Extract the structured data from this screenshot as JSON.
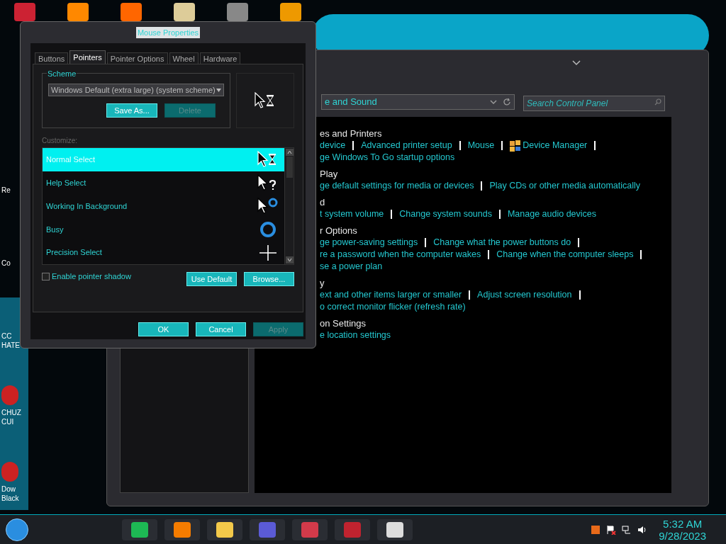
{
  "desktop": {
    "icon_labels": [
      {
        "lines": [
          "Re"
        ]
      },
      {
        "lines": [
          "Co"
        ]
      },
      {
        "lines": [
          "CC",
          "HATE"
        ]
      },
      {
        "lines": [
          "CHUZ",
          "CUI"
        ]
      },
      {
        "lines": [
          "Dow",
          "Black"
        ]
      }
    ]
  },
  "control_panel": {
    "address": "e and Sound",
    "search": {
      "placeholder": "Search Control Panel"
    },
    "sections": [
      {
        "heading": "es and Printers",
        "rows": [
          {
            "links": [
              {
                "text": "device",
                "kind": "plain"
              },
              {
                "text": "Advanced printer setup",
                "kind": "plain"
              },
              {
                "text": "Mouse",
                "kind": "plain"
              },
              {
                "text": "Device Manager",
                "kind": "with-icon"
              }
            ],
            "trailing_separator": true
          },
          {
            "links": [
              {
                "text": "ge Windows To Go startup options",
                "kind": "plain"
              }
            ],
            "trailing_separator": false
          }
        ]
      },
      {
        "heading": "Play",
        "rows": [
          {
            "links": [
              {
                "text": "ge default settings for media or devices",
                "kind": "plain"
              },
              {
                "text": "Play CDs or other media automatically",
                "kind": "plain"
              }
            ],
            "trailing_separator": false
          }
        ]
      },
      {
        "heading": "d",
        "rows": [
          {
            "links": [
              {
                "text": "t system volume",
                "kind": "plain"
              },
              {
                "text": "Change system sounds",
                "kind": "plain"
              },
              {
                "text": "Manage audio devices",
                "kind": "plain"
              }
            ],
            "trailing_separator": false
          }
        ]
      },
      {
        "heading": "r Options",
        "rows": [
          {
            "links": [
              {
                "text": "ge power-saving settings",
                "kind": "plain"
              },
              {
                "text": "Change what the power buttons do",
                "kind": "plain"
              }
            ],
            "trailing_separator": true
          },
          {
            "links": [
              {
                "text": "re a password when the computer wakes",
                "kind": "plain"
              },
              {
                "text": "Change when the computer sleeps",
                "kind": "plain"
              }
            ],
            "trailing_separator": true
          },
          {
            "links": [
              {
                "text": "se a power plan",
                "kind": "plain"
              }
            ],
            "trailing_separator": false
          }
        ]
      },
      {
        "heading": "y",
        "rows": [
          {
            "links": [
              {
                "text": "ext and other items larger or smaller",
                "kind": "plain"
              },
              {
                "text": "Adjust screen resolution",
                "kind": "plain"
              }
            ],
            "trailing_separator": true
          },
          {
            "links": [
              {
                "text": "o correct monitor flicker (refresh rate)",
                "kind": "plain"
              }
            ],
            "trailing_separator": false
          }
        ]
      },
      {
        "heading": "on Settings",
        "rows": [
          {
            "links": [
              {
                "text": "e location settings",
                "kind": "plain"
              }
            ],
            "trailing_separator": false
          }
        ]
      }
    ]
  },
  "dialog": {
    "title": "Mouse Properties",
    "tabs": [
      {
        "label": "Buttons",
        "selected": false
      },
      {
        "label": "Pointers",
        "selected": true
      },
      {
        "label": "Pointer Options",
        "selected": false
      },
      {
        "label": "Wheel",
        "selected": false
      },
      {
        "label": "Hardware",
        "selected": false
      }
    ],
    "scheme": {
      "label": "Scheme",
      "value": "Windows Default (extra large) (system scheme)",
      "buttons": [
        {
          "label": "Save As...",
          "disabled": false
        },
        {
          "label": "Delete",
          "disabled": true
        }
      ]
    },
    "customize_label": "Customize:",
    "pointers": [
      {
        "name": "Normal Select",
        "kind": "normal",
        "selected": true
      },
      {
        "name": "Help Select",
        "kind": "help",
        "selected": false
      },
      {
        "name": "Working In Background",
        "kind": "working",
        "selected": false
      },
      {
        "name": "Busy",
        "kind": "busy",
        "selected": false
      },
      {
        "name": "Precision Select",
        "kind": "precision",
        "selected": false
      }
    ],
    "shadow": {
      "label": "Enable pointer shadow",
      "checked": false
    },
    "list_buttons": [
      {
        "label": "Use Default",
        "disabled": false
      },
      {
        "label": "Browse...",
        "disabled": false
      }
    ],
    "footer_buttons": [
      {
        "label": "OK",
        "disabled": false
      },
      {
        "label": "Cancel",
        "disabled": false
      },
      {
        "label": "Apply",
        "disabled": true
      }
    ]
  },
  "taskbar": {
    "time": "5:32 AM",
    "date": "9/28/2023"
  }
}
